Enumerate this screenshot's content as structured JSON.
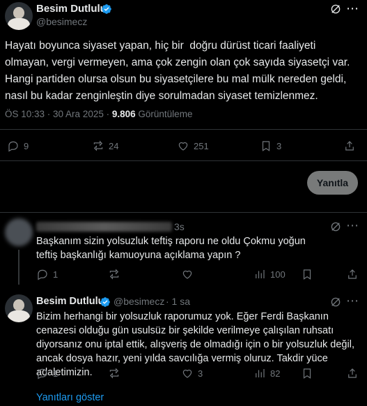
{
  "main_post": {
    "author_name": "Besim Dutlulu",
    "author_handle": "@besimecz",
    "text": "Hayatı boyunca siyaset yapan, hiç bir  doğru dürüst ticari faaliyeti olmayan, vergi vermeyen, ama çok zengin olan çok sayıda siyasetçi var. Hangi partiden olursa olsun bu siyasetçilere bu mal mülk nereden geldi, nasıl bu kadar zenginleştin diye sorulmadan siyaset temizlenmez.",
    "timestamp": "ÖS 10:33 · 30 Ara 2025 · ",
    "views_count": "9.806",
    "views_label": " Görüntüleme",
    "stats": {
      "replies": "9",
      "reposts": "24",
      "likes": "251",
      "bookmarks": "3"
    }
  },
  "reply_button": "Yanıtla",
  "comment": {
    "time": "3s",
    "text": "Başkanım sizin yolsuzluk teftiş raporu ne oldu Çokmu yoğun teftiş başkanlığı kamuoyuna açıklama yapın ?",
    "stats": {
      "replies": "1",
      "views": "100"
    }
  },
  "author_reply": {
    "author_name": "Besim Dutlulu",
    "author_handle": "@besimecz",
    "time": "· 1 sa",
    "text": "Bizim herhangi bir yolsuzluk raporumuz yok. Eğer Ferdi Başkanın cenazesi olduğu gün usulsüz bir şekilde verilmeye çalışılan ruhsatı diyorsanız onu iptal ettik, alışveriş de olmadığı için o bir yolsuzluk değil, ancak dosya hazır, yeni yılda savcılığa vermiş oluruz. Takdir yüce adaletimizin.",
    "stats": {
      "replies": "1",
      "likes": "3",
      "views": "82"
    }
  },
  "show_replies": "Yanıtları göster",
  "colors": {
    "accent": "#1d9bf0",
    "muted": "#71767b",
    "divider": "#2f3336"
  }
}
